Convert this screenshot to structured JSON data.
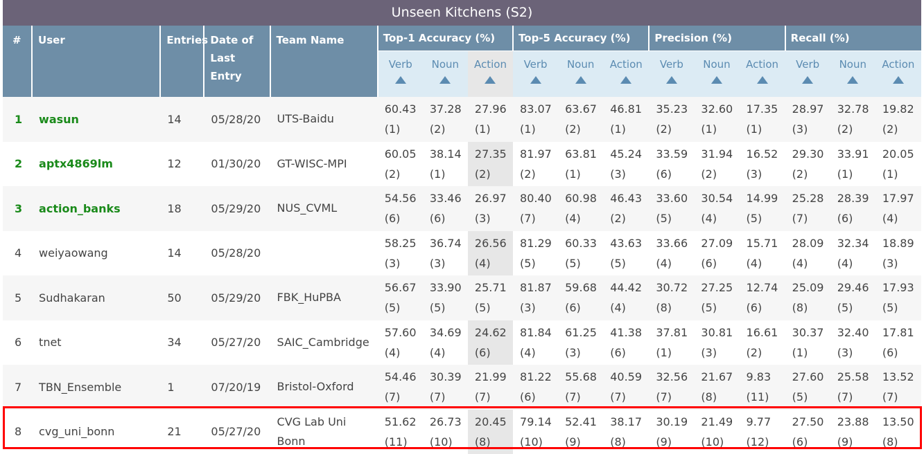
{
  "title": "Unseen Kitchens (S2)",
  "columns": {
    "rank": "#",
    "user": "User",
    "entries": "Entries",
    "date": "Date of Last Entry",
    "team": "Team Name"
  },
  "groups": [
    "Top-1 Accuracy (%)",
    "Top-5 Accuracy (%)",
    "Precision (%)",
    "Recall (%)"
  ],
  "subs": [
    "Verb",
    "Noun",
    "Action"
  ],
  "highlight_color": "#e7e7e7",
  "selection_color": "#ff0000",
  "rows": [
    {
      "rank": "1",
      "user": "wasun",
      "entries": "14",
      "date": "05/28/20",
      "team": "UTS-Baidu",
      "top3": true,
      "metrics": [
        [
          "60.43",
          "(1)"
        ],
        [
          "37.28",
          "(2)"
        ],
        [
          "27.96",
          "(1)"
        ],
        [
          "83.07",
          "(1)"
        ],
        [
          "63.67",
          "(2)"
        ],
        [
          "46.81",
          "(1)"
        ],
        [
          "35.23",
          "(2)"
        ],
        [
          "32.60",
          "(1)"
        ],
        [
          "17.35",
          "(1)"
        ],
        [
          "28.97",
          "(3)"
        ],
        [
          "32.78",
          "(2)"
        ],
        [
          "19.82",
          "(2)"
        ]
      ]
    },
    {
      "rank": "2",
      "user": "aptx4869lm",
      "entries": "12",
      "date": "01/30/20",
      "team": "GT-WISC-MPI",
      "top3": true,
      "metrics": [
        [
          "60.05",
          "(2)"
        ],
        [
          "38.14",
          "(1)"
        ],
        [
          "27.35",
          "(2)"
        ],
        [
          "81.97",
          "(2)"
        ],
        [
          "63.81",
          "(1)"
        ],
        [
          "45.24",
          "(3)"
        ],
        [
          "33.59",
          "(6)"
        ],
        [
          "31.94",
          "(2)"
        ],
        [
          "16.52",
          "(3)"
        ],
        [
          "29.30",
          "(2)"
        ],
        [
          "33.91",
          "(1)"
        ],
        [
          "20.05",
          "(1)"
        ]
      ]
    },
    {
      "rank": "3",
      "user": "action_banks",
      "entries": "18",
      "date": "05/29/20",
      "team": "NUS_CVML",
      "top3": true,
      "metrics": [
        [
          "54.56",
          "(6)"
        ],
        [
          "33.46",
          "(6)"
        ],
        [
          "26.97",
          "(3)"
        ],
        [
          "80.40",
          "(7)"
        ],
        [
          "60.98",
          "(4)"
        ],
        [
          "46.43",
          "(2)"
        ],
        [
          "33.60",
          "(5)"
        ],
        [
          "30.54",
          "(4)"
        ],
        [
          "14.99",
          "(5)"
        ],
        [
          "25.28",
          "(7)"
        ],
        [
          "28.39",
          "(6)"
        ],
        [
          "17.97",
          "(4)"
        ]
      ]
    },
    {
      "rank": "4",
      "user": "weiyaowang",
      "entries": "14",
      "date": "05/28/20",
      "team": "",
      "top3": false,
      "metrics": [
        [
          "58.25",
          "(3)"
        ],
        [
          "36.74",
          "(3)"
        ],
        [
          "26.56",
          "(4)"
        ],
        [
          "81.29",
          "(5)"
        ],
        [
          "60.33",
          "(5)"
        ],
        [
          "43.63",
          "(5)"
        ],
        [
          "33.66",
          "(4)"
        ],
        [
          "27.09",
          "(6)"
        ],
        [
          "15.71",
          "(4)"
        ],
        [
          "28.09",
          "(4)"
        ],
        [
          "32.34",
          "(4)"
        ],
        [
          "18.89",
          "(3)"
        ]
      ]
    },
    {
      "rank": "5",
      "user": "Sudhakaran",
      "entries": "50",
      "date": "05/29/20",
      "team": "FBK_HuPBA",
      "top3": false,
      "metrics": [
        [
          "56.67",
          "(5)"
        ],
        [
          "33.90",
          "(5)"
        ],
        [
          "25.71",
          "(5)"
        ],
        [
          "81.87",
          "(3)"
        ],
        [
          "59.68",
          "(6)"
        ],
        [
          "44.42",
          "(4)"
        ],
        [
          "30.72",
          "(8)"
        ],
        [
          "27.25",
          "(5)"
        ],
        [
          "12.74",
          "(6)"
        ],
        [
          "25.09",
          "(8)"
        ],
        [
          "29.46",
          "(5)"
        ],
        [
          "17.93",
          "(5)"
        ]
      ]
    },
    {
      "rank": "6",
      "user": "tnet",
      "entries": "34",
      "date": "05/27/20",
      "team": "SAIC_Cambridge",
      "top3": false,
      "metrics": [
        [
          "57.60",
          "(4)"
        ],
        [
          "34.69",
          "(4)"
        ],
        [
          "24.62",
          "(6)"
        ],
        [
          "81.84",
          "(4)"
        ],
        [
          "61.25",
          "(3)"
        ],
        [
          "41.38",
          "(6)"
        ],
        [
          "37.81",
          "(1)"
        ],
        [
          "30.81",
          "(3)"
        ],
        [
          "16.61",
          "(2)"
        ],
        [
          "30.37",
          "(1)"
        ],
        [
          "32.40",
          "(3)"
        ],
        [
          "17.81",
          "(6)"
        ]
      ]
    },
    {
      "rank": "7",
      "user": "TBN_Ensemble",
      "entries": "1",
      "date": "07/20/19",
      "team": "Bristol-Oxford",
      "top3": false,
      "metrics": [
        [
          "54.46",
          "(7)"
        ],
        [
          "30.39",
          "(7)"
        ],
        [
          "21.99",
          "(7)"
        ],
        [
          "81.22",
          "(6)"
        ],
        [
          "55.68",
          "(7)"
        ],
        [
          "40.59",
          "(7)"
        ],
        [
          "32.56",
          "(7)"
        ],
        [
          "21.67",
          "(8)"
        ],
        [
          "9.83",
          "(11)"
        ],
        [
          "27.60",
          "(5)"
        ],
        [
          "25.58",
          "(7)"
        ],
        [
          "13.52",
          "(7)"
        ]
      ]
    },
    {
      "rank": "8",
      "user": "cvg_uni_bonn",
      "entries": "21",
      "date": "05/27/20",
      "team": "CVG Lab Uni Bonn",
      "top3": false,
      "metrics": [
        [
          "51.62",
          "(11)"
        ],
        [
          "26.73",
          "(10)"
        ],
        [
          "20.45",
          "(8)"
        ],
        [
          "79.14",
          "(10)"
        ],
        [
          "52.41",
          "(9)"
        ],
        [
          "38.17",
          "(8)"
        ],
        [
          "30.19",
          "(9)"
        ],
        [
          "21.49",
          "(10)"
        ],
        [
          "9.77",
          "(12)"
        ],
        [
          "27.50",
          "(6)"
        ],
        [
          "23.88",
          "(9)"
        ],
        [
          "13.50",
          "(8)"
        ]
      ]
    }
  ]
}
